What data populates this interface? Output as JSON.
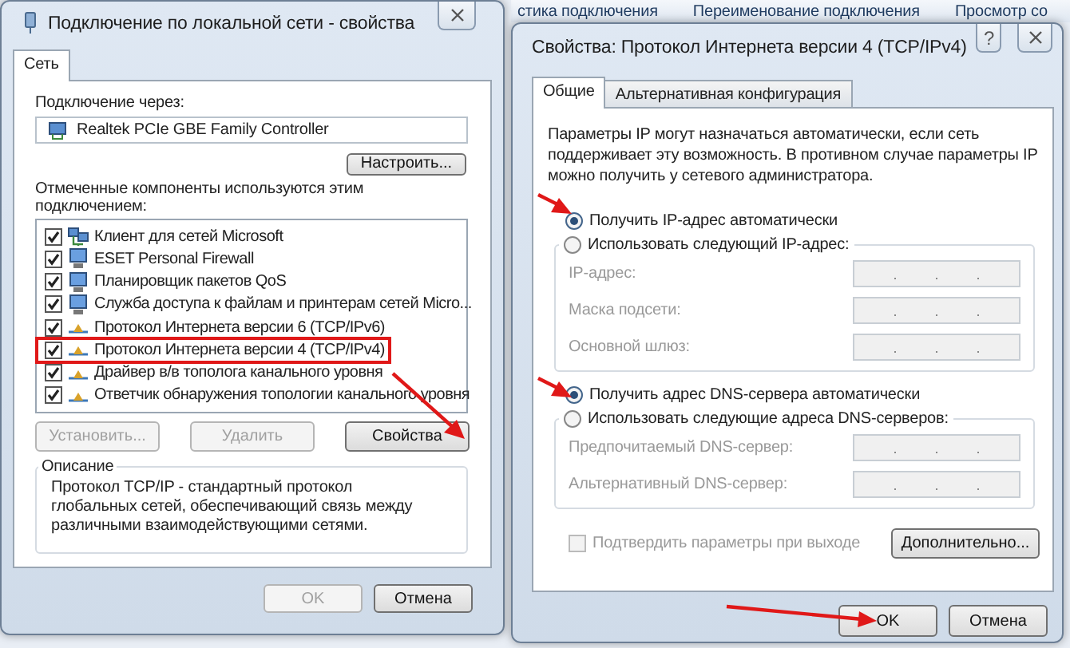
{
  "background_toolbar": {
    "items": [
      "стика подключения",
      "Переименование подключения",
      "Просмотр со"
    ]
  },
  "connection_window": {
    "title": "Подключение по локальной сети - свойства",
    "tabs": [
      {
        "label": "Сеть",
        "selected": true
      }
    ],
    "connect_using_label": "Подключение через:",
    "adapter": "Realtek PCIe GBE Family Controller",
    "configure_button": "Настроить...",
    "components_label": "Отмеченные компоненты используются этим подключением:",
    "components": [
      {
        "name": "Клиент для сетей Microsoft",
        "checked": true,
        "kind": "client",
        "highlighted": false
      },
      {
        "name": "ESET Personal Firewall",
        "checked": true,
        "kind": "service",
        "highlighted": false
      },
      {
        "name": "Планировщик пакетов QoS",
        "checked": true,
        "kind": "service",
        "highlighted": false
      },
      {
        "name": "Служба доступа к файлам и принтерам сетей Micro...",
        "checked": true,
        "kind": "service",
        "highlighted": false
      },
      {
        "name": "Протокол Интернета версии 6 (TCP/IPv6)",
        "checked": true,
        "kind": "protocol",
        "highlighted": false
      },
      {
        "name": "Протокол Интернета версии 4 (TCP/IPv4)",
        "checked": true,
        "kind": "protocol",
        "highlighted": true
      },
      {
        "name": "Драйвер в/в тополога канального уровня",
        "checked": true,
        "kind": "protocol",
        "highlighted": false
      },
      {
        "name": "Ответчик обнаружения топологии канального уровня",
        "checked": true,
        "kind": "protocol",
        "highlighted": false
      }
    ],
    "component_buttons": [
      {
        "label": "Установить...",
        "disabled": true
      },
      {
        "label": "Удалить",
        "disabled": true
      },
      {
        "label": "Свойства",
        "disabled": false
      }
    ],
    "description": {
      "title": "Описание",
      "text": "Протокол TCP/IP - стандартный протокол глобальных сетей, обеспечивающий связь между различными взаимодействующими сетями."
    },
    "buttons": [
      {
        "label": "OK",
        "disabled": true
      },
      {
        "label": "Отмена",
        "disabled": false
      }
    ]
  },
  "ipv4_window": {
    "title": "Свойства: Протокол Интернета версии 4 (TCP/IPv4)",
    "help_button": "?",
    "tabs": [
      {
        "label": "Общие",
        "selected": true
      },
      {
        "label": "Альтернативная конфигурация",
        "selected": false
      }
    ],
    "intro": "Параметры IP могут назначаться автоматически, если сеть поддерживает эту возможность. В противном случае параметры IP можно получить у сетевого администратора.",
    "ip_mode": [
      {
        "label": "Получить IP-адрес автоматически",
        "selected": true
      },
      {
        "label": "Использовать следующий IP-адрес:",
        "selected": false
      }
    ],
    "ip_fields": [
      {
        "label": "IP-адрес:",
        "disabled": true
      },
      {
        "label": "Маска подсети:",
        "disabled": true
      },
      {
        "label": "Основной шлюз:",
        "disabled": true
      }
    ],
    "dns_mode": [
      {
        "label": "Получить адрес DNS-сервера автоматически",
        "selected": true
      },
      {
        "label": "Использовать следующие адреса DNS-серверов:",
        "selected": false
      }
    ],
    "dns_fields": [
      {
        "label": "Предпочитаемый DNS-сервер:",
        "disabled": true
      },
      {
        "label": "Альтернативный DNS-сервер:",
        "disabled": true
      }
    ],
    "validate_checkbox": {
      "label": "Подтвердить параметры при выходе",
      "checked": false,
      "disabled": true
    },
    "advanced_button": "Дополнительно...",
    "buttons": [
      {
        "label": "OK"
      },
      {
        "label": "Отмена"
      }
    ]
  }
}
